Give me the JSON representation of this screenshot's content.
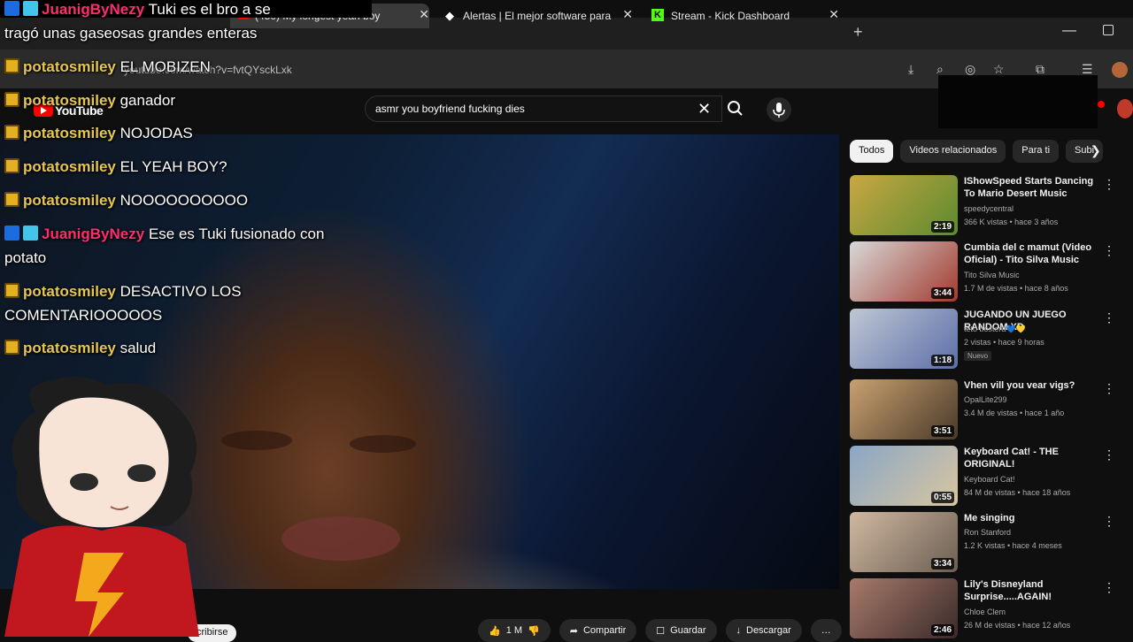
{
  "browser": {
    "tabs": [
      {
        "label": "(450) My longest yeah boy",
        "close": "✕"
      },
      {
        "label": "Alertas | El mejor software para",
        "close": "✕"
      },
      {
        "label": "Stream - Kick Dashboard",
        "close": "✕"
      }
    ],
    "new_tab": "+",
    "minimize": "—",
    "url": "youtube.com/watch?v=fvtQYsckLxk"
  },
  "youtube": {
    "logo_text": "YouTube",
    "search_query": "asmr you boyfriend fucking dies",
    "subscribe_label": "cribirse",
    "actions": {
      "like_count": "1 M",
      "share": "Compartir",
      "save": "Guardar",
      "download": "Descargar",
      "more": "…"
    },
    "chips": [
      "Todos",
      "Videos relacionados",
      "Para ti",
      "Subi"
    ],
    "recommendations": [
      {
        "title": "IShowSpeed Starts Dancing To Mario Desert Music",
        "channel": "speedycentral",
        "meta": "366 K vistas • hace 3 años",
        "duration": "2:19",
        "thumb_colors": [
          "#c9a742",
          "#5b8a2f"
        ]
      },
      {
        "title": "Cumbia del c mamut (Video Oficial) - Tito Silva Music",
        "channel": "Tito Silva Music",
        "meta": "1.7 M de vistas • hace 8 años",
        "duration": "3:44",
        "thumb_colors": [
          "#d8d8d8",
          "#a23a2e"
        ]
      },
      {
        "title": "JUGANDO UN JUEGO RANDOM XD",
        "channel": "teto bostera💙💛",
        "meta": "2 vistas • hace 9 horas",
        "badge": "Nuevo",
        "duration": "1:18",
        "thumb_colors": [
          "#bfc6d4",
          "#5c6fa8"
        ]
      },
      {
        "title": "Vhen vill you vear vigs?",
        "channel": "OpalLite299",
        "meta": "3.4 M de vistas • hace 1 año",
        "duration": "3:51",
        "thumb_colors": [
          "#c8a070",
          "#4a3a2a"
        ]
      },
      {
        "title": "Keyboard Cat! - THE ORIGINAL!",
        "channel": "Keyboard Cat!",
        "meta": "84 M de vistas • hace 18 años",
        "duration": "0:55",
        "thumb_colors": [
          "#8aa6c6",
          "#d8c6a0"
        ]
      },
      {
        "title": "Me singing",
        "channel": "Ron Stanford",
        "meta": "1.2 K vistas • hace 4 meses",
        "duration": "3:34",
        "thumb_colors": [
          "#d0b8a0",
          "#6b5e52"
        ]
      },
      {
        "title": "Lily's Disneyland Surprise.....AGAIN!",
        "channel": "Chloe Clem",
        "meta": "26 M de vistas • hace 12 años",
        "duration": "2:46",
        "thumb_colors": [
          "#a87a6a",
          "#3a2a2a"
        ]
      }
    ]
  },
  "chat": [
    {
      "user": "JuanigByNezy",
      "style": "a",
      "badges": [
        "blue",
        "cyan"
      ],
      "message": "Tuki es el bro a se"
    },
    {
      "user": "",
      "style": "none",
      "badges": [],
      "message": "tragó unas gaseosas grandes enteras"
    },
    {
      "user": "potatosmiley",
      "style": "b",
      "badges": [
        "gold"
      ],
      "message": "EL MOBIZEN"
    },
    {
      "user": "potatosmiley",
      "style": "b",
      "badges": [
        "gold"
      ],
      "message": "ganador"
    },
    {
      "user": "potatosmiley",
      "style": "b",
      "badges": [
        "gold"
      ],
      "message": "NOJODAS"
    },
    {
      "user": "potatosmiley",
      "style": "b",
      "badges": [
        "gold"
      ],
      "message": "EL YEAH BOY?"
    },
    {
      "user": "potatosmiley",
      "style": "b",
      "badges": [
        "gold"
      ],
      "message": "NOOOOOOOOOO"
    },
    {
      "user": "JuanigByNezy",
      "style": "a",
      "badges": [
        "blue",
        "cyan"
      ],
      "message": "Ese es Tuki fusionado con potato"
    },
    {
      "user": "potatosmiley",
      "style": "b",
      "badges": [
        "gold"
      ],
      "message": "DESACTIVO LOS COMENTARIOOOOOS"
    },
    {
      "user": "potatosmiley",
      "style": "b",
      "badges": [
        "gold"
      ],
      "message": "salud"
    }
  ],
  "icons": {
    "close": "x-icon",
    "search": "search-icon",
    "mic": "mic-icon",
    "like": "thumbs-up-icon",
    "dislike": "thumbs-down-icon",
    "share": "share-icon",
    "save": "save-icon",
    "download": "download-icon"
  }
}
